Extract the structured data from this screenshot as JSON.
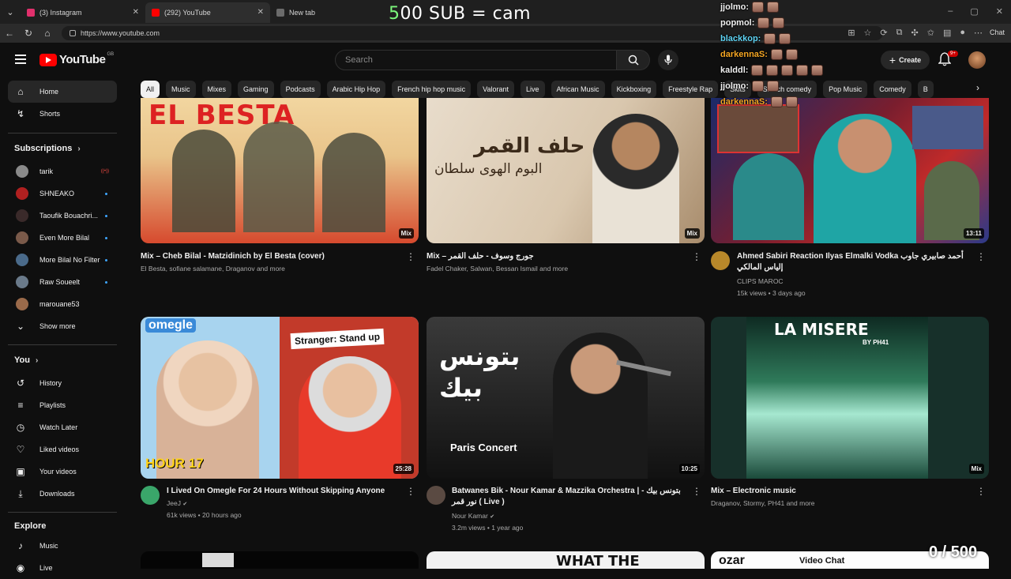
{
  "browser": {
    "tabs": [
      {
        "title": "(3) Instagram",
        "favicon_color": "#e1306c",
        "active": false
      },
      {
        "title": "(292) YouTube",
        "favicon_color": "#ff0000",
        "active": true
      },
      {
        "title": "New tab",
        "favicon_color": "#6b6b6b",
        "active": false
      }
    ],
    "url": "https://www.youtube.com",
    "chat_button": "Chat"
  },
  "overlay": {
    "sub_goal_prefix": "5",
    "sub_goal_text": "00 SUB = cam",
    "counter": "0 / 500"
  },
  "stream_chat": [
    {
      "user": "jjolmo:",
      "color": "#ffffff",
      "emotes": 2
    },
    {
      "user": "popmol:",
      "color": "#ffffff",
      "emotes": 2
    },
    {
      "user": "blackkop:",
      "color": "#5fd3f3",
      "emotes": 2
    },
    {
      "user": "darkennaS:",
      "color": "#f5a623",
      "emotes": 2
    },
    {
      "user": "kalddl:",
      "color": "#ffffff",
      "emotes": 5
    },
    {
      "user": "jjolmo:",
      "color": "#ffffff",
      "emotes": 2
    },
    {
      "user": "darkennaS:",
      "color": "#f5a623",
      "emotes": 2
    }
  ],
  "header": {
    "logo_text": "YouTube",
    "country_code": "GB",
    "search_placeholder": "Search",
    "create_label": "Create",
    "notif_count": "9+"
  },
  "sidebar": {
    "main": [
      {
        "label": "Home",
        "icon": "home-icon",
        "glyph": "⌂",
        "active": true
      },
      {
        "label": "Shorts",
        "icon": "shorts-icon",
        "glyph": "↯",
        "active": false
      }
    ],
    "subscriptions_title": "Subscriptions",
    "subscriptions": [
      {
        "label": "tarik",
        "color": "#8a8a8a",
        "status": "live"
      },
      {
        "label": "SHNEAKO",
        "color": "#b02020",
        "status": "dot"
      },
      {
        "label": "Taoufik Bouachri...",
        "color": "#3a2a2a",
        "status": "dot"
      },
      {
        "label": "Even More Bilal",
        "color": "#7a5a4a",
        "status": "dot"
      },
      {
        "label": "More Bilal No Filter",
        "color": "#4a6a8a",
        "status": "dot"
      },
      {
        "label": "Raw Soueelt",
        "color": "#6a7a8a",
        "status": "dot"
      },
      {
        "label": "marouane53",
        "color": "#9a6a4a",
        "status": "none"
      }
    ],
    "show_more": "Show more",
    "you_title": "You",
    "you_items": [
      {
        "label": "History",
        "icon": "history-icon",
        "glyph": "↺"
      },
      {
        "label": "Playlists",
        "icon": "playlists-icon",
        "glyph": "≡"
      },
      {
        "label": "Watch Later",
        "icon": "watch-later-icon",
        "glyph": "◷"
      },
      {
        "label": "Liked videos",
        "icon": "like-icon",
        "glyph": "👍"
      },
      {
        "label": "Your videos",
        "icon": "your-videos-icon",
        "glyph": "▣"
      },
      {
        "label": "Downloads",
        "icon": "download-icon",
        "glyph": "⤓"
      }
    ],
    "explore_title": "Explore",
    "explore_items": [
      {
        "label": "Music",
        "icon": "music-icon",
        "glyph": "♪"
      },
      {
        "label": "Live",
        "icon": "live-icon",
        "glyph": "◉"
      }
    ]
  },
  "chips": [
    "All",
    "Music",
    "Mixes",
    "Gaming",
    "Podcasts",
    "Arabic Hip Hop",
    "French hip hop music",
    "Valorant",
    "Live",
    "African Music",
    "Kickboxing",
    "Freestyle Rap",
    "Skits",
    "Sketch comedy",
    "Pop Music",
    "Comedy",
    "B"
  ],
  "videos": [
    {
      "title": "Mix – Cheb Bilal - Matzidinich by El Besta (cover)",
      "line1": "El Besta, sofiane salamane, Draganov and more",
      "line2": "",
      "badge": "Mix",
      "thumb_text": "EL BESTA",
      "has_avatar": false,
      "avatar_color": "",
      "verified": false
    },
    {
      "title": "Mix – جورج وسوف - حلف القمر",
      "line1": "Fadel Chaker, Salwan, Bessan Ismail and more",
      "line2": "",
      "badge": "Mix",
      "thumb_text": "حلف القمر",
      "thumb_text2": "البوم الهوى سلطان",
      "has_avatar": false,
      "avatar_color": "",
      "verified": false
    },
    {
      "title": "Ahmed Sabiri Reaction Ilyas Elmalki Vodka أحمد صابيري جاوب إلياس المالكي",
      "line1": "CLIPS MAROC",
      "line2": "15k views • 3 days ago",
      "badge": "13:11",
      "has_avatar": true,
      "avatar_color": "#b8882a",
      "verified": false
    },
    {
      "title": "I Lived On Omegle For 24 Hours Without Skipping Anyone",
      "line1": "JeeJ",
      "line2": "61k views • 20 hours ago",
      "badge": "25:28",
      "thumb_text": "omegle",
      "thumb_text2": "Stranger: Stand up",
      "thumb_text3": "HOUR 17",
      "has_avatar": true,
      "avatar_color": "#3aa66a",
      "verified": true
    },
    {
      "title": "Batwanes Bik - Nour Kamar & Mazzika Orchestra | بتونس بيك - نور قمر ( Live )",
      "line1": "Nour Kamar",
      "line2": "3.2m views • 1 year ago",
      "badge": "10:25",
      "thumb_text": "بتونس بيك",
      "thumb_text2": "Paris Concert",
      "has_avatar": true,
      "avatar_color": "#5a4a42",
      "verified": true
    },
    {
      "title": "Mix – Electronic music",
      "line1": "Draganov, Stormy, PH41 and more",
      "line2": "",
      "badge": "Mix",
      "thumb_text": "LA MISERE",
      "thumb_text2": "BY PH41",
      "has_avatar": false,
      "avatar_color": "",
      "verified": false
    }
  ],
  "bottom_peek": {
    "middle_text": "WHAT THE",
    "right_text": "ozar",
    "right_text2": "Video Chat"
  },
  "colors": {
    "background": "#0f0f0f",
    "accent_red": "#ff0000",
    "chip_bg": "#272727",
    "secondary_text": "#aaaaaa"
  }
}
